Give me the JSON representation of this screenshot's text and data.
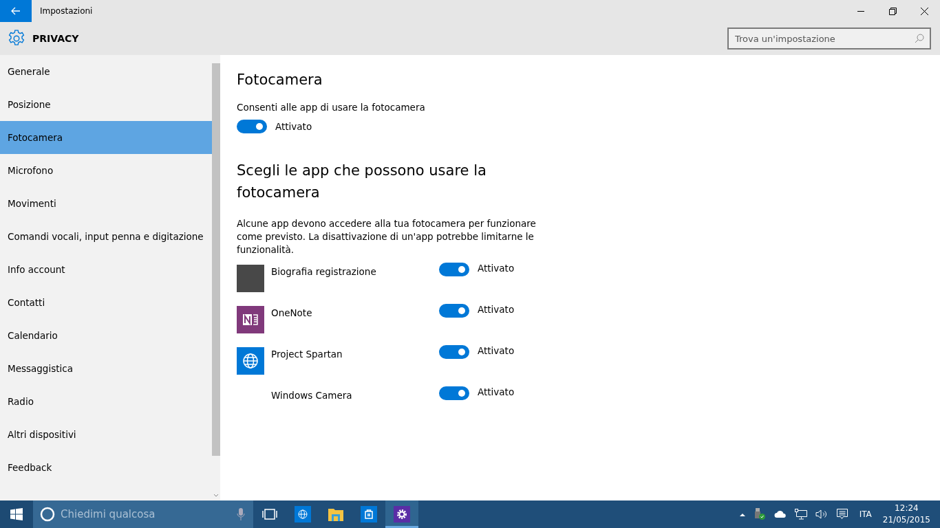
{
  "window": {
    "title": "Impostazioni"
  },
  "header": {
    "title": "PRIVACY",
    "search": {
      "placeholder": "Trova un'impostazione"
    }
  },
  "sidebar": {
    "items": [
      {
        "label": "Generale",
        "selected": false
      },
      {
        "label": "Posizione",
        "selected": false
      },
      {
        "label": "Fotocamera",
        "selected": true
      },
      {
        "label": "Microfono",
        "selected": false
      },
      {
        "label": "Movimenti",
        "selected": false
      },
      {
        "label": "Comandi vocali, input penna e digitazione",
        "selected": false
      },
      {
        "label": "Info account",
        "selected": false
      },
      {
        "label": "Contatti",
        "selected": false
      },
      {
        "label": "Calendario",
        "selected": false
      },
      {
        "label": "Messaggistica",
        "selected": false
      },
      {
        "label": "Radio",
        "selected": false
      },
      {
        "label": "Altri dispositivi",
        "selected": false
      },
      {
        "label": "Feedback",
        "selected": false
      }
    ]
  },
  "content": {
    "title": "Fotocamera",
    "master": {
      "label": "Consenti alle app di usare la fotocamera",
      "on": true,
      "state": "Attivato"
    },
    "section_title": "Scegli le app che possono usare la fotocamera",
    "description": "Alcune app devono accedere alla tua fotocamera per funzionare come previsto. La disattivazione di un'app potrebbe limitarne le funzionalità.",
    "apps": [
      {
        "name": "Biografia registrazione",
        "kind": "block",
        "on": true,
        "state": "Attivato"
      },
      {
        "name": "OneNote",
        "kind": "onenote",
        "on": true,
        "state": "Attivato"
      },
      {
        "name": "Project Spartan",
        "kind": "browser",
        "on": true,
        "state": "Attivato"
      },
      {
        "name": "Windows Camera",
        "kind": "none",
        "on": true,
        "state": "Attivato"
      }
    ]
  },
  "taskbar": {
    "search": {
      "placeholder": "Chiedimi qualcosa"
    },
    "apps": [
      {
        "kind": "browser",
        "selected": false
      },
      {
        "kind": "explorer",
        "selected": false
      },
      {
        "kind": "store",
        "selected": false
      },
      {
        "kind": "settings",
        "selected": true
      }
    ],
    "language": "ITA",
    "time": "12:24",
    "date": "21/05/2015"
  }
}
